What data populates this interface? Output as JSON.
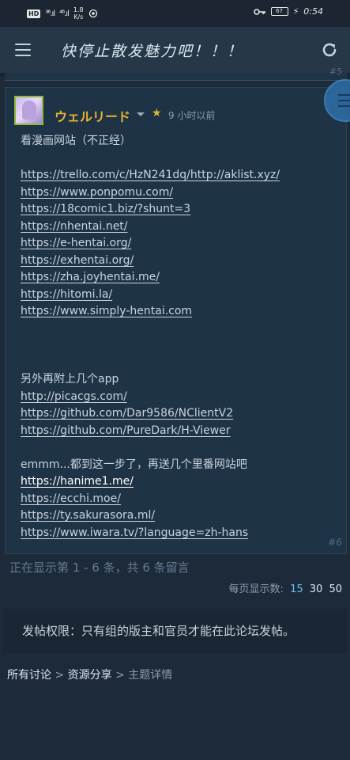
{
  "status_bar": {
    "hd_label": "HD",
    "network_1": "³⁶.ıl",
    "network_2": "⁴⁶.ıl",
    "speed_value": "1.8",
    "speed_unit": "K/s",
    "battery_level": "67",
    "clock": "0:54"
  },
  "header": {
    "title": "快停止散发魅力吧！！！"
  },
  "prev_post": {
    "number": "#5"
  },
  "post": {
    "author": "ウェルリード",
    "time": "9 小时以前",
    "number": "#6",
    "lines": [
      {
        "type": "text",
        "text": "看漫画网站（不正经）"
      },
      {
        "type": "blank",
        "text": ""
      },
      {
        "type": "link",
        "text": "https://trello.com/c/HzN241dq/http://aklist.xyz/"
      },
      {
        "type": "link",
        "text": "https://www.ponpomu.com/"
      },
      {
        "type": "link",
        "text": "https://18comic1.biz/?shunt=3"
      },
      {
        "type": "link",
        "text": "https://nhentai.net/"
      },
      {
        "type": "link",
        "text": "https://e-hentai.org/"
      },
      {
        "type": "link",
        "text": "https://exhentai.org/"
      },
      {
        "type": "link",
        "text": "https://zha.joyhentai.me/"
      },
      {
        "type": "link",
        "text": "https://hitomi.la/"
      },
      {
        "type": "link",
        "text": "https://www.simply-hentai.com"
      },
      {
        "type": "blank",
        "text": ""
      },
      {
        "type": "blank",
        "text": ""
      },
      {
        "type": "blank",
        "text": ""
      },
      {
        "type": "text",
        "text": "另外再附上几个app"
      },
      {
        "type": "link",
        "text": "http://picacgs.com/"
      },
      {
        "type": "link",
        "text": "https://github.com/Dar9586/NClientV2"
      },
      {
        "type": "link",
        "text": "https://github.com/PureDark/H-Viewer"
      },
      {
        "type": "blank",
        "text": ""
      },
      {
        "type": "text",
        "text": "emmm...都到这一步了，再送几个里番网站吧"
      },
      {
        "type": "link-bright",
        "text": "https://hanime1.me/"
      },
      {
        "type": "link",
        "text": "https://ecchi.moe/"
      },
      {
        "type": "link",
        "text": "https://ty.sakurasora.ml/"
      },
      {
        "type": "link",
        "text": "https://www.iwara.tv/?language=zh-hans"
      }
    ]
  },
  "pagination": {
    "showing": "正在显示第 1 - 6 条，共 6 条留言",
    "per_page_label": "每页显示数:",
    "per_page_options": [
      "15",
      "30",
      "50"
    ],
    "selected_per_page": "15"
  },
  "permissions": {
    "text": "发帖权限：只有组的版主和官员才能在此论坛发帖。"
  },
  "breadcrumb": {
    "items": [
      "所有讨论",
      "资源分享",
      "主题详情"
    ],
    "separator": ">"
  },
  "colors": {
    "background": "#1d2a3a",
    "header": "#263748",
    "post_bg": "#1f3347",
    "author": "#e5b52a",
    "selected": "#66c0f4"
  }
}
